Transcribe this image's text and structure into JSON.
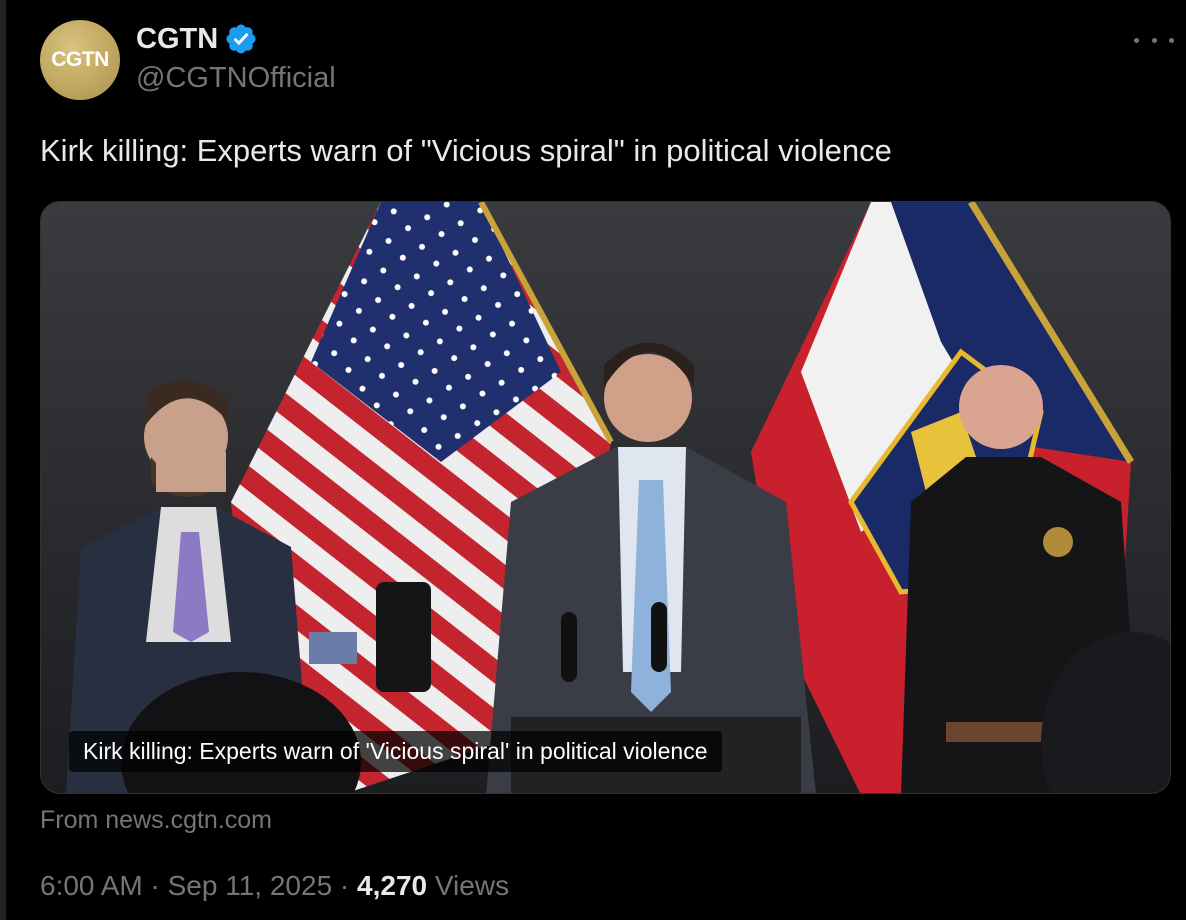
{
  "account": {
    "avatar_text": "CGTN",
    "display_name": "CGTN",
    "handle": "@CGTNOfficial"
  },
  "tweet": {
    "text": "Kirk killing: Experts warn of \"Vicious spiral\" in political violence"
  },
  "card": {
    "title": "Kirk killing: Experts warn of 'Vicious spiral' in political violence",
    "source": "From news.cgtn.com",
    "image_description_icon": "press-conference-photo"
  },
  "meta": {
    "time": "6:00 AM",
    "separator": "·",
    "date": "Sep 11, 2025",
    "views_count": "4,270",
    "views_label": "Views"
  },
  "colors": {
    "background": "#000000",
    "text_primary": "#e7e9ea",
    "text_secondary": "#71767b",
    "verified": "#1d9bf0",
    "avatar_gold": "#c2aa63"
  },
  "icons": {
    "verified": "verified-badge-icon",
    "more": "more-options-icon"
  }
}
